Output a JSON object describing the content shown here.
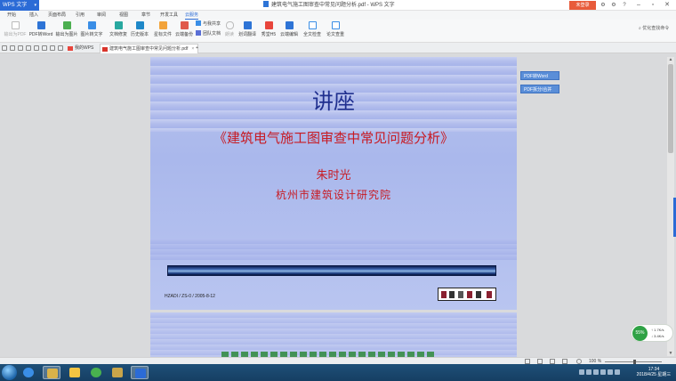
{
  "app": {
    "menu_button": "WPS 文字",
    "window_title": "建筑电气施工图审查中常见问题分析.pdf - WPS 文字",
    "login_button": "未登录"
  },
  "menu": [
    "开始",
    "插入",
    "页面布局",
    "引用",
    "审阅",
    "视图",
    "章节",
    "开发工具",
    "云服务"
  ],
  "menu_active": "云服务",
  "ribbon": {
    "export_pdf": "输出为PDF",
    "pdf_to_word": "PDF转Word",
    "export_image": "输出为图片",
    "image_to_text": "图片转文字",
    "doc_repair": "文档修复",
    "history": "历史版本",
    "star_file": "星标文件",
    "cloud_backup": "云端备份",
    "share": "与我共享",
    "team_docs": "团队文档",
    "speech": "朗读",
    "translate": "划词翻译",
    "h5": "秀堂H5",
    "cloud_edit": "云端编辑",
    "full_check": "全文检查",
    "paper_check": "论文查重",
    "search": "优化查找命令"
  },
  "tabs": {
    "home": "我的WPS",
    "doc": "建筑电气施工图审查中常见问题分析.pdf",
    "add": "+"
  },
  "slide": {
    "lecture": "讲座",
    "title": "《建筑电气施工图审查中常见问题分析》",
    "author": "朱时光",
    "org": "杭州市建筑设计研究院",
    "code": "HZADI / ZS-0 / 2005-8-12"
  },
  "side_buttons": {
    "pdf_to_word": "PDF转Word",
    "pdf_split": "PDF拆分/合并"
  },
  "net_widget": {
    "percent": "55%",
    "up": "1.7K/s",
    "down": "3.4K/s"
  },
  "status": {
    "zoom": "100 %"
  },
  "clock": {
    "time": "17:34",
    "date": "2018/4/25 星期三"
  },
  "colors": {
    "accent": "#2b6bd6",
    "slide_title_red": "#c81a22",
    "lecture_blue": "#1f2f8f",
    "login_orange": "#e85b3a"
  }
}
